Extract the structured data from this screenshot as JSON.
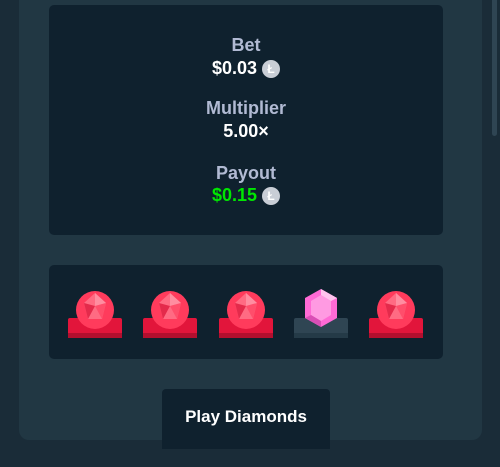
{
  "summary": {
    "bet_label": "Bet",
    "bet_value": "$0.03",
    "multiplier_label": "Multiplier",
    "multiplier_value": "5.00×",
    "payout_label": "Payout",
    "payout_value": "$0.15",
    "currency_icon": "litecoin-icon",
    "payout_color": "#00e701"
  },
  "gems": [
    {
      "type": "red-gem",
      "state": "matched"
    },
    {
      "type": "red-gem",
      "state": "matched"
    },
    {
      "type": "red-gem",
      "state": "matched"
    },
    {
      "type": "pink-gem",
      "state": "unmatched"
    },
    {
      "type": "red-gem",
      "state": "matched"
    }
  ],
  "colors": {
    "red_gem": "#ff3b5c",
    "pink_gem": "#ff6ad5",
    "matched_base": "#e2153b",
    "unmatched_base": "#2f4553"
  },
  "play_button": {
    "label": "Play Diamonds"
  }
}
